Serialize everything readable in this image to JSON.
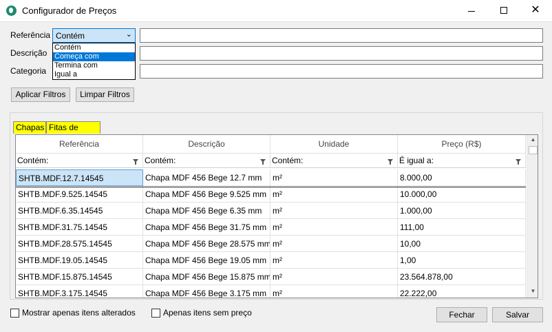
{
  "window": {
    "title": "Configurador de Preços"
  },
  "filters": {
    "referencia_label": "Referência",
    "descricao_label": "Descrição",
    "categoria_label": "Categoria",
    "combo_value": "Contém",
    "options": [
      "Contém",
      "Começa com",
      "Termina com",
      "Igual a"
    ],
    "selected_option_index": 1
  },
  "buttons": {
    "apply": "Aplicar Filtros",
    "clear": "Limpar Filtros",
    "close": "Fechar",
    "save": "Salvar"
  },
  "tabs": [
    {
      "label": "Chapas"
    },
    {
      "label": "Fitas de borda"
    }
  ],
  "grid": {
    "columns": [
      "Referência",
      "Descrição",
      "Unidade",
      "Preço (R$)"
    ],
    "filters": [
      "Contém:",
      "Contém:",
      "Contém:",
      "É igual a:"
    ],
    "rows": [
      [
        "SHTB.MDF.12.7.14545",
        "Chapa MDF 456 Bege 12.7 mm",
        "m²",
        "8.000,00"
      ],
      [
        "SHTB.MDF.9.525.14545",
        "Chapa MDF 456 Bege 9.525 mm",
        "m²",
        "10.000,00"
      ],
      [
        "SHTB.MDF.6.35.14545",
        "Chapa MDF 456 Bege 6.35 mm",
        "m²",
        "1.000,00"
      ],
      [
        "SHTB.MDF.31.75.14545",
        "Chapa MDF 456 Bege 31.75 mm",
        "m²",
        "111,00"
      ],
      [
        "SHTB.MDF.28.575.14545",
        "Chapa MDF 456 Bege 28.575 mm",
        "m²",
        "10,00"
      ],
      [
        "SHTB.MDF.19.05.14545",
        "Chapa MDF 456 Bege 19.05 mm",
        "m²",
        "1,00"
      ],
      [
        "SHTB.MDF.15.875.14545",
        "Chapa MDF 456 Bege 15.875 mm",
        "m²",
        "23.564.878,00"
      ],
      [
        "SHTB.MDF.3.175.14545",
        "Chapa MDF 456 Bege 3.175 mm",
        "m²",
        "22.222,00"
      ]
    ]
  },
  "checkboxes": {
    "only_changed": "Mostrar apenas itens alterados",
    "no_price": "Apenas itens sem preço"
  },
  "colors": {
    "tab_highlight": "#ffff00",
    "selection": "#0078d7",
    "selected_cell": "#cce4f7"
  },
  "icons": {
    "app": "app-logo-icon",
    "filter": "funnel-icon"
  }
}
